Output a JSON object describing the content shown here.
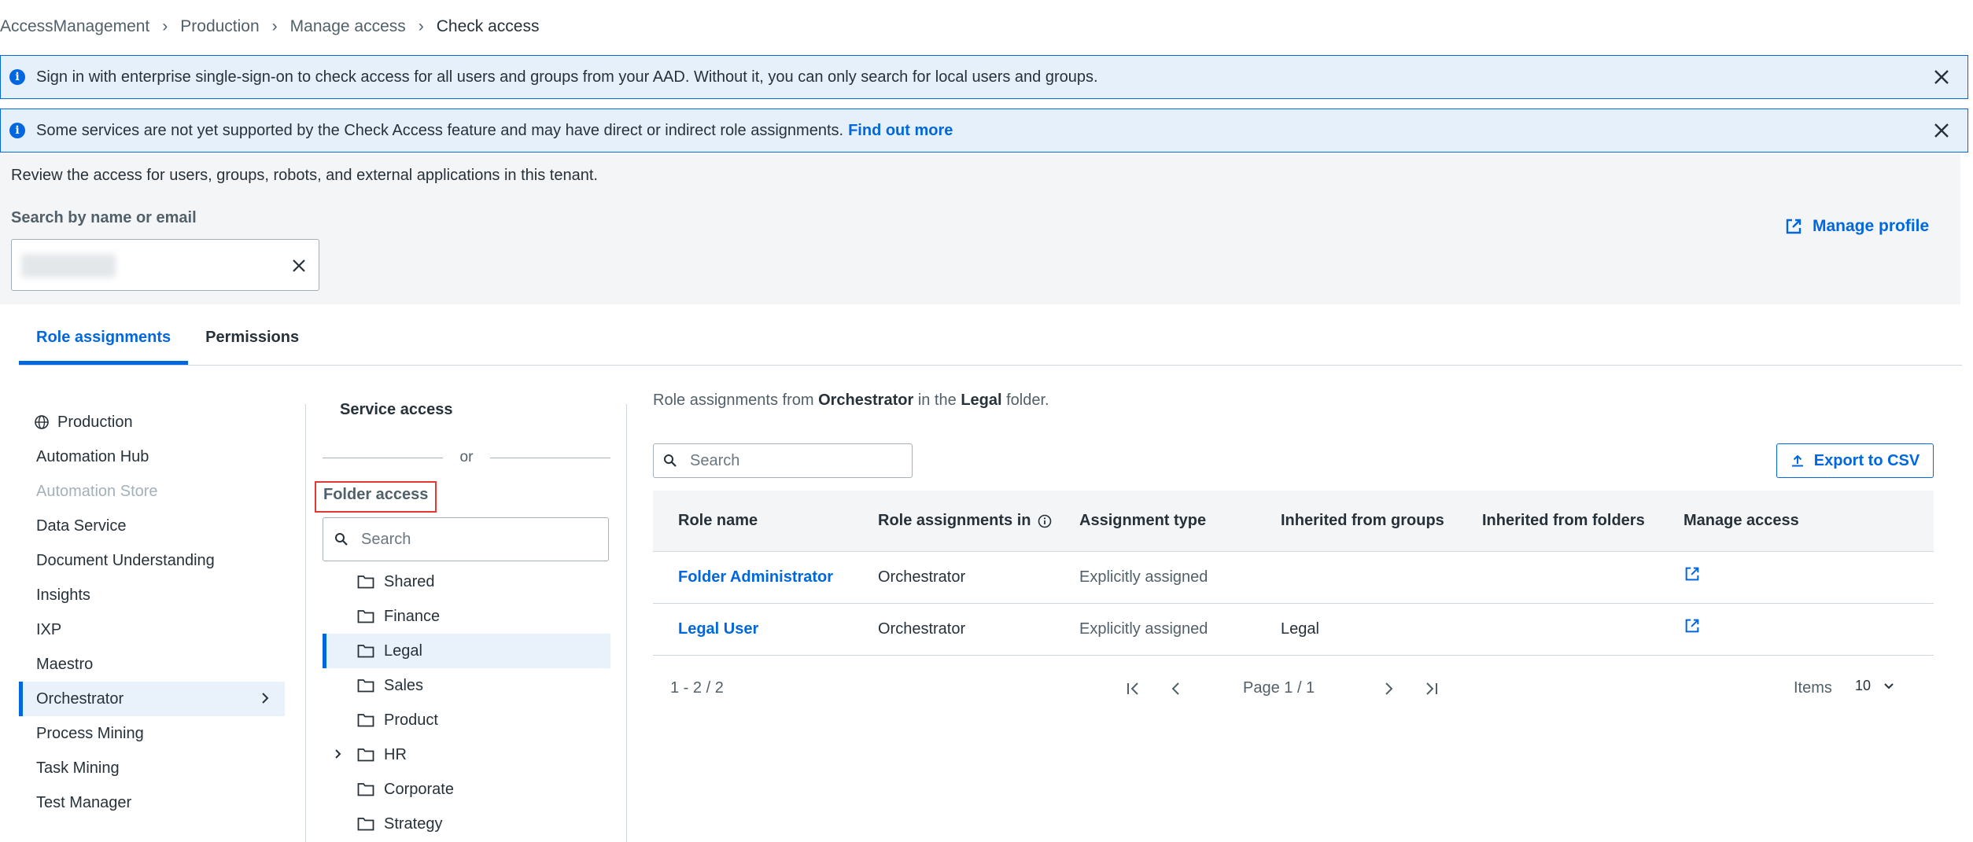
{
  "breadcrumb": [
    "AccessManagement",
    "Production",
    "Manage access",
    "Check access"
  ],
  "banners": [
    {
      "text": "Sign in with enterprise single-sign-on to check access for all users and groups from your AAD. Without it, you can only search for local users and groups.",
      "link": ""
    },
    {
      "text": "Some services are not yet supported by the Check Access feature and may have direct or indirect role assignments.",
      "link": "Find out more"
    }
  ],
  "description": "Review the access for users, groups, robots, and external applications in this tenant.",
  "search": {
    "label": "Search by name or email"
  },
  "manage_profile": "Manage profile",
  "tabs": [
    "Role assignments",
    "Permissions"
  ],
  "services": [
    {
      "label": "Production",
      "icon": "globe-icon"
    },
    {
      "label": "Automation Hub"
    },
    {
      "label": "Automation Store",
      "disabled": true
    },
    {
      "label": "Data Service"
    },
    {
      "label": "Document Understanding"
    },
    {
      "label": "Insights"
    },
    {
      "label": "IXP"
    },
    {
      "label": "Maestro"
    },
    {
      "label": "Orchestrator",
      "selected": true
    },
    {
      "label": "Process Mining"
    },
    {
      "label": "Task Mining"
    },
    {
      "label": "Test Manager"
    }
  ],
  "middle": {
    "service_access": "Service access",
    "or": "or",
    "folder_access": "Folder access",
    "search_placeholder": "Search",
    "folders": [
      {
        "label": "Shared"
      },
      {
        "label": "Finance"
      },
      {
        "label": "Legal",
        "selected": true
      },
      {
        "label": "Sales"
      },
      {
        "label": "Product"
      },
      {
        "label": "HR",
        "expandable": true
      },
      {
        "label": "Corporate"
      },
      {
        "label": "Strategy"
      }
    ]
  },
  "right": {
    "caption_prefix": "Role assignments from",
    "caption_service": "Orchestrator",
    "caption_mid": "in the",
    "caption_folder": "Legal",
    "caption_suffix": "folder.",
    "search_placeholder": "Search",
    "export_label": "Export to CSV",
    "columns": [
      "Role name",
      "Role assignments in",
      "Assignment type",
      "Inherited from groups",
      "Inherited from folders",
      "Manage access"
    ],
    "rows": [
      {
        "role": "Folder Administrator",
        "in": "Orchestrator",
        "type": "Explicitly assigned",
        "groups": "",
        "folders": ""
      },
      {
        "role": "Legal User",
        "in": "Orchestrator",
        "type": "Explicitly assigned",
        "groups": "Legal",
        "folders": ""
      }
    ],
    "pagination": {
      "range": "1 - 2 / 2",
      "page": "Page 1 / 1",
      "items_label": "Items",
      "items_value": "10"
    }
  },
  "colors": {
    "accent": "#0067df",
    "banner_bg": "#e6f0fa",
    "highlight": "#e53935"
  }
}
